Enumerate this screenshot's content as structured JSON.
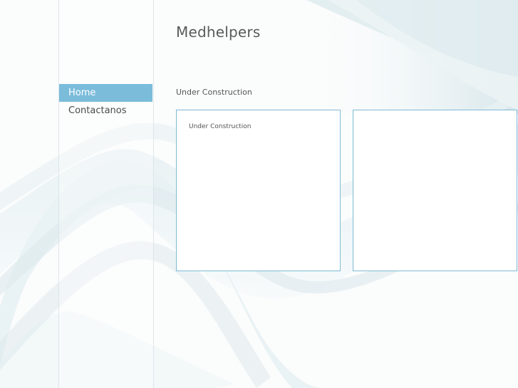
{
  "site": {
    "title": "Medhelpers"
  },
  "nav": {
    "items": [
      {
        "label": "Home",
        "active": true
      },
      {
        "label": "Contactanos",
        "active": false
      }
    ]
  },
  "main": {
    "heading": "Under Construction",
    "panels": [
      {
        "text": "Under Construction"
      },
      {
        "text": ""
      }
    ]
  },
  "colors": {
    "accent": "#7bbcdb",
    "panel_border": "#7fbad6",
    "text": "#555555",
    "title": "#5a5a5a"
  }
}
